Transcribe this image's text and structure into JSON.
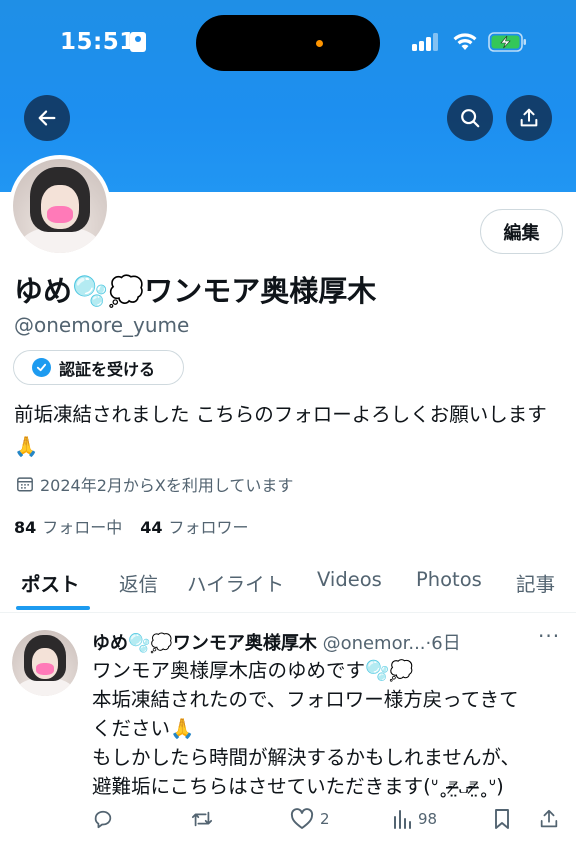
{
  "status_bar": {
    "time": "15:51"
  },
  "profile": {
    "edit_label": "編集",
    "display_name": "ゆめ🫧💭ワンモア奥様厚木",
    "handle": "@onemore_yume",
    "verify_label": "認証を受ける",
    "bio": "前垢凍結されました こちらのフォローよろしくお願いします🙏",
    "joined": "2024年2月からXを利用しています",
    "following_count": "84",
    "following_label": "フォロー中",
    "followers_count": "44",
    "followers_label": "フォロワー"
  },
  "tabs": [
    {
      "label": "ポスト",
      "active": true
    },
    {
      "label": "返信",
      "active": false
    },
    {
      "label": "ハイライト",
      "active": false
    },
    {
      "label": "Videos",
      "active": false
    },
    {
      "label": "Photos",
      "active": false
    },
    {
      "label": "記事",
      "active": false
    }
  ],
  "post": {
    "name": "ゆめ🫧💭ワンモア奥様厚木",
    "handle": "@onemor...",
    "time": "·6日",
    "more": "···",
    "lines": [
      "ワンモア奥様厚木店のゆめです🫧💭",
      "本垢凍結されたので、フォロワー様方戻ってきて",
      "ください🙏",
      "もしかしたら時間が解決するかもしれませんが、",
      "避難垢にこちらはさせていただきます(ᐡ˳⁼̴̶̷̤᎑⁼̴̶̷̤˳ᐡ)"
    ],
    "likes": "2",
    "views": "98"
  },
  "colors": {
    "accent": "#1d9bf0",
    "banner": "#1d8ff0",
    "muted": "#536471"
  }
}
